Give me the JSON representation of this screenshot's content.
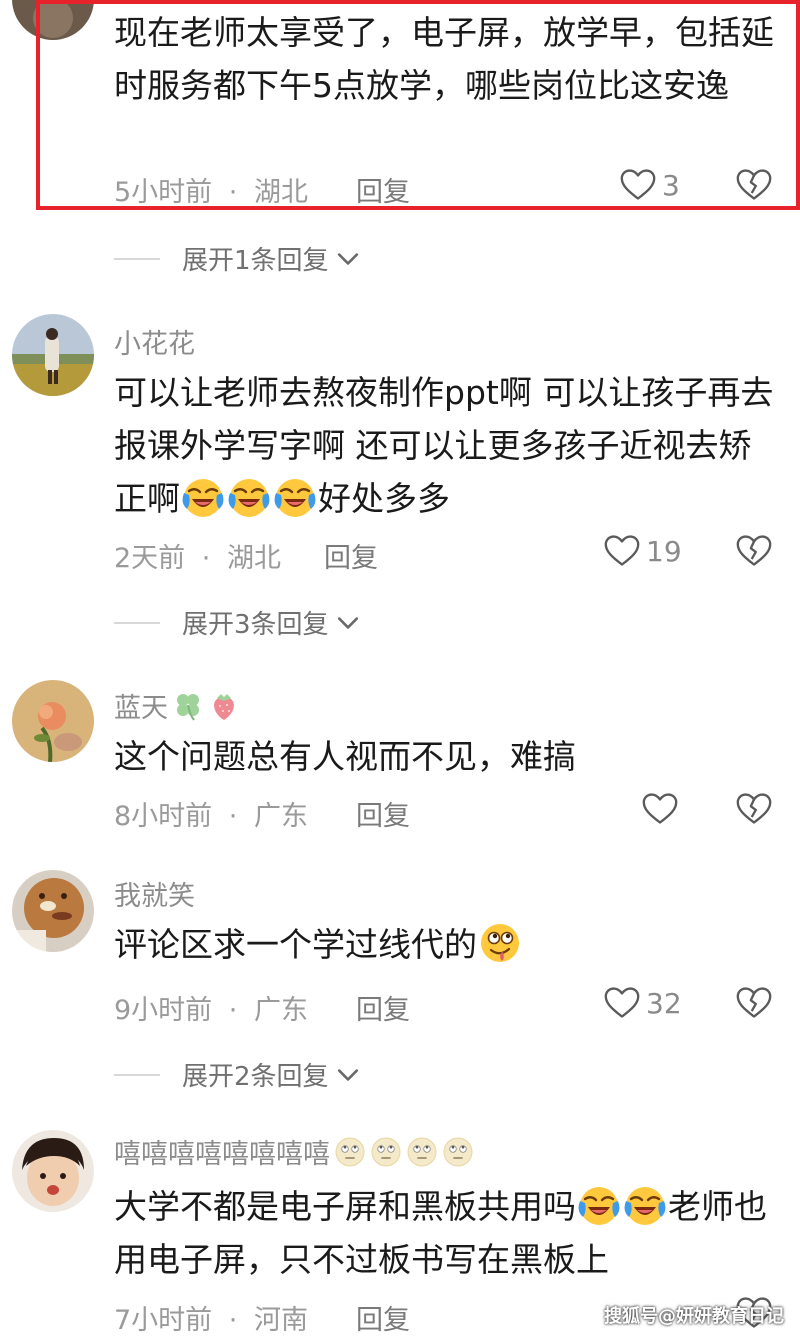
{
  "comments": [
    {
      "text": "现在老师太享受了，电子屏，放学早，包括延时服务都下午5点放学，哪些岗位比这安逸",
      "time": "5小时前",
      "sep": "·",
      "location": "湖北",
      "reply": "回复",
      "likes": "3",
      "expand": "展开1条回复"
    },
    {
      "username": "小花花",
      "text": "可以让老师去熬夜制作ppt啊 可以让孩子再去报课外学写字啊 还可以让更多孩子近视去矫正啊",
      "text_tail": "好处多多",
      "time": "2天前",
      "sep": "·",
      "location": "湖北",
      "reply": "回复",
      "likes": "19",
      "expand": "展开3条回复"
    },
    {
      "username": "蓝天",
      "text": "这个问题总有人视而不见，难搞",
      "time": "8小时前",
      "sep": "·",
      "location": "广东",
      "reply": "回复",
      "likes": ""
    },
    {
      "username": "我就笑",
      "text": "评论区求一个学过线代的",
      "time": "9小时前",
      "sep": "·",
      "location": "广东",
      "reply": "回复",
      "likes": "32",
      "expand": "展开2条回复"
    },
    {
      "username": "嘻嘻嘻嘻嘻嘻嘻嘻",
      "text": "大学不都是电子屏和黑板共用吗",
      "text_tail": "老师也用电子屏，只不过板书写在黑板上",
      "time": "7小时前",
      "sep": "·",
      "location": "河南",
      "reply": "回复"
    }
  ],
  "watermark": "搜狐号@妍妍教育日记",
  "icons": [
    "heart-icon",
    "broken-heart-icon",
    "chevron-down-icon",
    "crying-laughing-emoji",
    "clover-emoji",
    "strawberry-emoji",
    "drooling-emoji",
    "eyeroll-emoji"
  ],
  "colors": {
    "highlight": "#e8222a",
    "meta": "#9a9a9a",
    "text": "#1a1a1a"
  }
}
